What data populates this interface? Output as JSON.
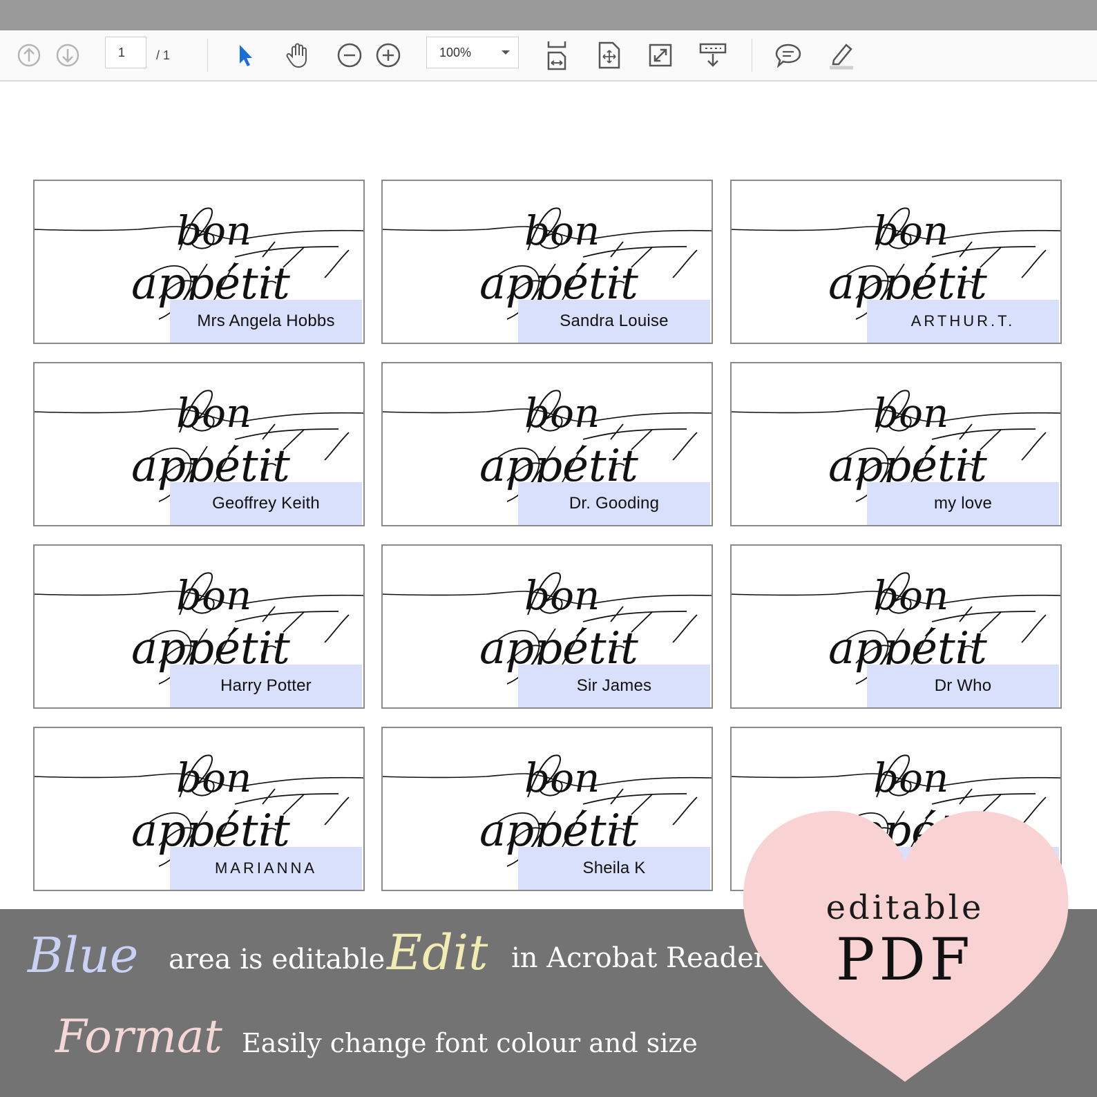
{
  "toolbar": {
    "page_current": "1",
    "page_total": "/ 1",
    "zoom": "100%",
    "icons": [
      "prev-page-icon",
      "next-page-icon",
      "select-cursor-icon",
      "hand-tool-icon",
      "zoom-out-icon",
      "zoom-in-icon",
      "scroll-mode-icon",
      "page-fit-icon",
      "fullscreen-icon",
      "read-mode-icon",
      "comment-icon",
      "highlight-icon"
    ]
  },
  "cards": [
    {
      "name": "Mrs Angela Hobbs"
    },
    {
      "name": "Sandra Louise"
    },
    {
      "name": "ARTHUR.T."
    },
    {
      "name": "Geoffrey Keith"
    },
    {
      "name": "Dr. Gooding"
    },
    {
      "name": "my love"
    },
    {
      "name": "Harry Potter"
    },
    {
      "name": "Sir James"
    },
    {
      "name": "Dr Who"
    },
    {
      "name": "MARIANNA"
    },
    {
      "name": "Sheila K"
    },
    {
      "name": ""
    }
  ],
  "card_script": {
    "line1": "bon",
    "line2": "appétit"
  },
  "banner": {
    "blue_word": "Blue",
    "blue_text": "area is editable",
    "edit_word": "Edit",
    "edit_text": "in Acrobat Reader",
    "format_word": "Format",
    "format_text": "Easily change font colour and size"
  },
  "badge": {
    "line1": "editable",
    "line2": "PDF"
  },
  "colors": {
    "editable_field": "#d9e0fb",
    "banner": "#737373",
    "heart": "#f9d3d3",
    "blue_word": "#c9d2f5",
    "edit_word": "#f1ecb4",
    "format_word": "#f6d7d7"
  }
}
